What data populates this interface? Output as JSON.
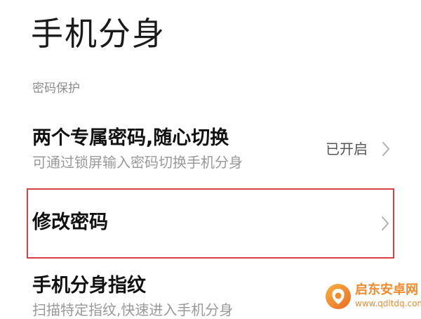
{
  "header": {
    "title": "手机分身"
  },
  "section": {
    "label": "密码保护"
  },
  "rows": {
    "dual_password": {
      "title": "两个专属密码,随心切换",
      "subtitle": "可通过锁屏输入密码切换手机分身",
      "status": "已开启"
    },
    "change_password": {
      "title": "修改密码"
    },
    "fingerprint": {
      "title": "手机分身指纹",
      "subtitle": "扫描特定指纹,快速进入手机分身"
    }
  },
  "watermark": {
    "name": "启东安卓网",
    "url": "www.qdltdq.com"
  },
  "colors": {
    "highlight_border": "#d94040",
    "watermark": "#f08a2c",
    "chevron": "#b0b0b0"
  },
  "icons": {
    "chevron": "chevron-right-icon",
    "watermark_logo": "watermark-logo-icon"
  }
}
